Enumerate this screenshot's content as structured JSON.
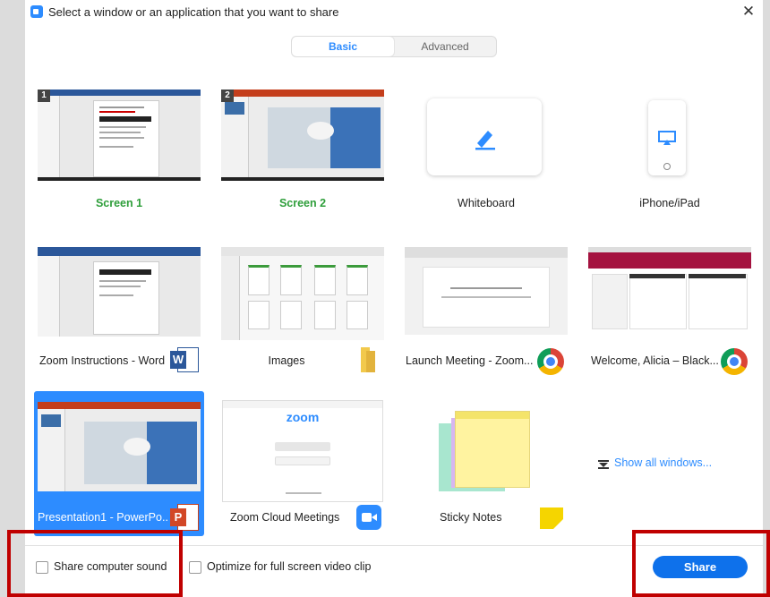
{
  "dialog": {
    "title": "Select a window or an application that you want to share",
    "close_glyph": "✕"
  },
  "tabs": [
    {
      "label": "Basic",
      "selected": true
    },
    {
      "label": "Advanced",
      "selected": false
    }
  ],
  "tiles": [
    {
      "label": "Screen 1",
      "badge": "1"
    },
    {
      "label": "Screen 2",
      "badge": "2"
    },
    {
      "label": "Whiteboard"
    },
    {
      "label": "iPhone/iPad"
    },
    {
      "label": "Zoom Instructions - Word",
      "icon": "word-icon"
    },
    {
      "label": "Images",
      "icon": "folder-icon"
    },
    {
      "label": "Launch Meeting - Zoom...",
      "icon": "chrome-icon"
    },
    {
      "label": "Welcome, Alicia – Black...",
      "icon": "chrome-icon"
    },
    {
      "label": "Presentation1 - PowerPo...",
      "icon": "powerpoint-icon",
      "selected": true
    },
    {
      "label": "Zoom Cloud Meetings",
      "icon": "zoom-icon"
    },
    {
      "label": "Sticky Notes",
      "icon": "sticky-notes-icon"
    }
  ],
  "zoom_thumb": {
    "logo": "zoom"
  },
  "show_all": "Show all windows...",
  "bottom": {
    "share_sound": "Share computer sound",
    "optimize": "Optimize for full screen video clip",
    "share_button": "Share"
  },
  "colors": {
    "accent": "#2d8cff",
    "share_button": "#0e71eb",
    "screen_label": "#2e9e3a",
    "highlight_box": "#c00000"
  }
}
